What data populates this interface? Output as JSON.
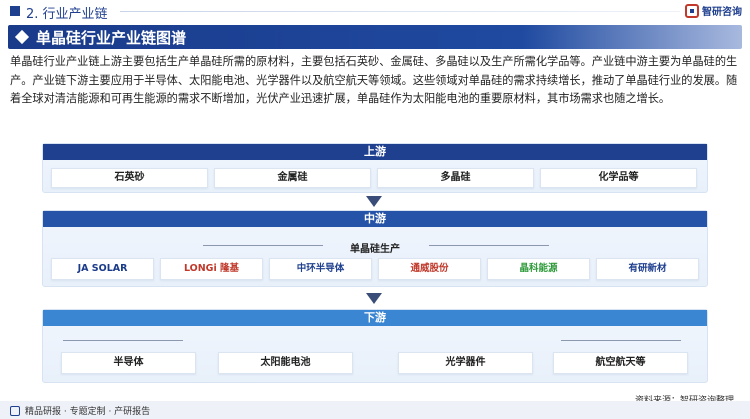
{
  "header": {
    "section_title": "2. 行业产业链",
    "brand": "智研咨询"
  },
  "banner": {
    "title": "单晶硅行业产业链图谱"
  },
  "intro": "单晶硅行业产业链上游主要包括生产单晶硅所需的原材料，主要包括石英砂、金属硅、多晶硅以及生产所需化学品等。产业链中游主要为单晶硅的生产。产业链下游主要应用于半导体、太阳能电池、光学器件以及航空航天等领域。这些领域对单晶硅的需求持续增长，推动了单晶硅行业的发展。随着全球对清洁能源和可再生能源的需求不断增加，光伏产业迅速扩展，单晶硅作为太阳能电池的重要原材料，其市场需求也随之增长。",
  "upstream": {
    "title": "上游",
    "items": [
      "石英砂",
      "金属硅",
      "多晶硅",
      "化学品等"
    ]
  },
  "midstream": {
    "title": "中游",
    "subtitle": "单晶硅生产",
    "companies": [
      "JA SOLAR",
      "LONGi 隆基",
      "中环半导体",
      "通威股份",
      "晶科能源",
      "有研新材"
    ]
  },
  "downstream": {
    "title": "下游",
    "items": [
      "半导体",
      "太阳能电池",
      "光学器件",
      "航空航天等"
    ]
  },
  "footer": {
    "left": "精品研报 · 专题定制 · 产研报告",
    "source": "资料来源：智研咨询整理"
  },
  "colors": {
    "primary": "#1f3f8f",
    "secondary": "#2553a8",
    "accent": "#3b86d3"
  }
}
